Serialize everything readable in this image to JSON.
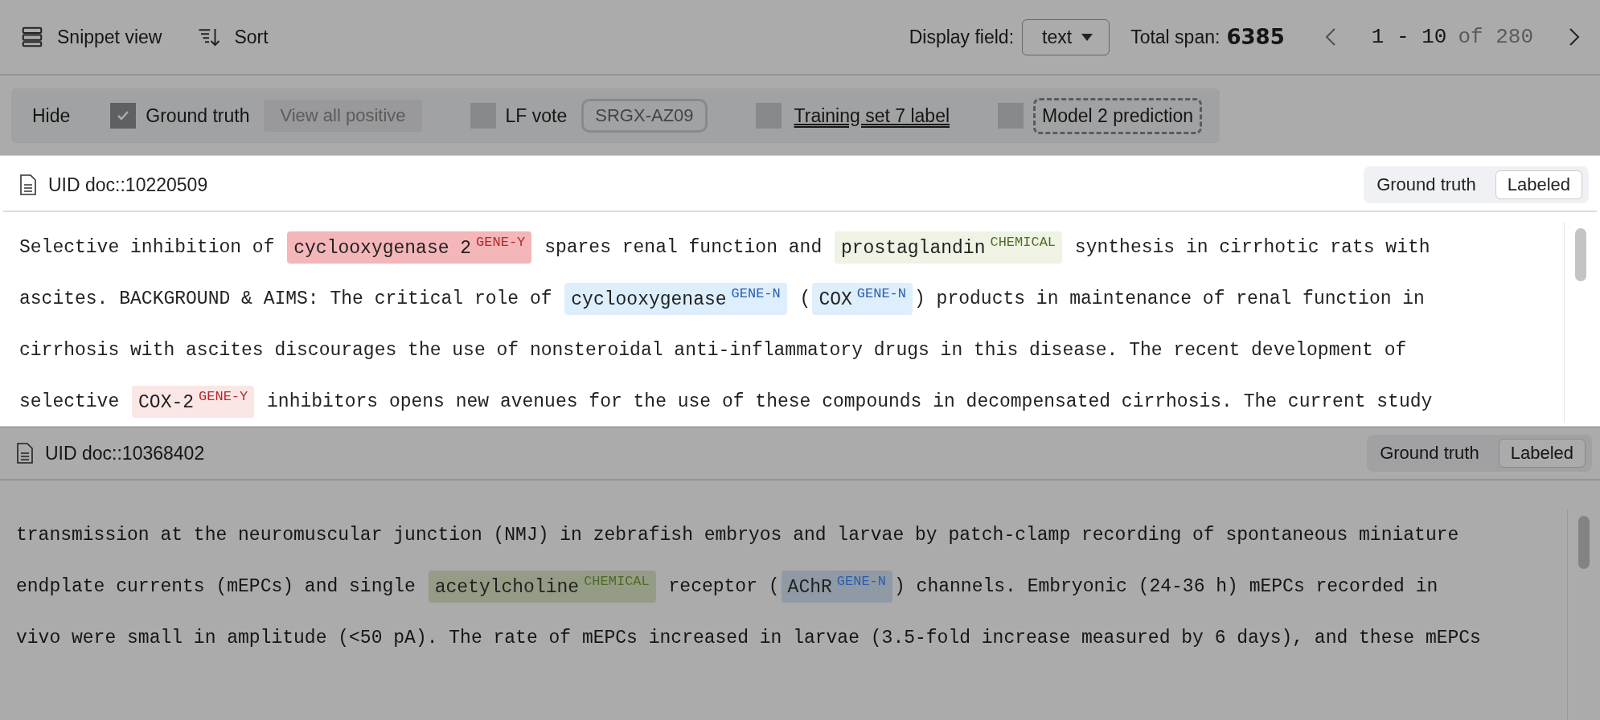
{
  "toolbar": {
    "view_label": "Snippet view",
    "sort_label": "Sort",
    "display_field_label": "Display field:",
    "display_field_value": "text",
    "total_span_label": "Total span:",
    "total_span_value": "6385",
    "page_range": "1 - 10",
    "page_total": "of 280"
  },
  "filters": {
    "hide_label": "Hide",
    "items": [
      {
        "label": "Ground truth",
        "checked": true,
        "kind": "plain",
        "action": "View all positive"
      },
      {
        "label": "LF vote",
        "checked": false,
        "kind": "plain",
        "tag": "SRGX-AZ09"
      },
      {
        "label": "Training set 7 label",
        "checked": false,
        "kind": "underlined"
      },
      {
        "label": "Model 2 prediction",
        "checked": false,
        "kind": "dashed"
      }
    ]
  },
  "documents": [
    {
      "uid": "UID doc::10220509",
      "highlighted": true,
      "status_label": "Ground truth",
      "status_value": "Labeled",
      "lines": [
        [
          {
            "text": "Selective inhibition of "
          },
          {
            "text": "cyclooxygenase 2",
            "label": "GENE-Y",
            "kind": "gene_y",
            "color": "#f4b6b8"
          },
          {
            "text": " spares renal function and "
          },
          {
            "text": "prostaglandin",
            "label": "CHEMICAL",
            "kind": "chemical",
            "color": "#eef3e4"
          },
          {
            "text": " synthesis in cirrhotic rats with"
          }
        ],
        [
          {
            "text": "ascites. BACKGROUND & AIMS: The critical role of "
          },
          {
            "text": "cyclooxygenase",
            "label": "GENE-N",
            "kind": "gene_n",
            "color": "#ddeefc"
          },
          {
            "text": " ("
          },
          {
            "text": "COX",
            "label": "GENE-N",
            "kind": "gene_n",
            "color": "#ddeefc"
          },
          {
            "text": ") products in maintenance of renal function in"
          }
        ],
        [
          {
            "text": "cirrhosis with ascites discourages the use of nonsteroidal anti-inflammatory drugs in this disease. The recent development of"
          }
        ],
        [
          {
            "text": "selective "
          },
          {
            "text": "COX-2",
            "label": "GENE-Y",
            "kind": "gene_y",
            "color": "#fbe6e6"
          },
          {
            "text": " inhibitors opens new avenues for the use of these compounds in decompensated cirrhosis. The current study"
          }
        ]
      ]
    },
    {
      "uid": "UID doc::10368402",
      "highlighted": false,
      "status_label": "Ground truth",
      "status_value": "Labeled",
      "lines": [
        [
          {
            "text": "transmission at the neuromuscular junction (NMJ) in zebrafish embryos and larvae by patch-clamp recording of spontaneous miniature"
          }
        ],
        [
          {
            "text": "endplate currents (mEPCs) and single "
          },
          {
            "text": "acetylcholine",
            "label": "CHEMICAL",
            "kind": "chemical",
            "color": "#959c86"
          },
          {
            "text": " receptor ("
          },
          {
            "text": "AChR",
            "label": "GENE-N",
            "kind": "gene_n",
            "color": "#8f9aa4"
          },
          {
            "text": ") channels. Embryonic (24-36 h) mEPCs recorded in"
          }
        ],
        [
          {
            "text": "vivo were small in amplitude (<50 pA). The rate of mEPCs increased in larvae (3.5-fold increase measured by 6 days), and these mEPCs"
          }
        ]
      ]
    }
  ]
}
